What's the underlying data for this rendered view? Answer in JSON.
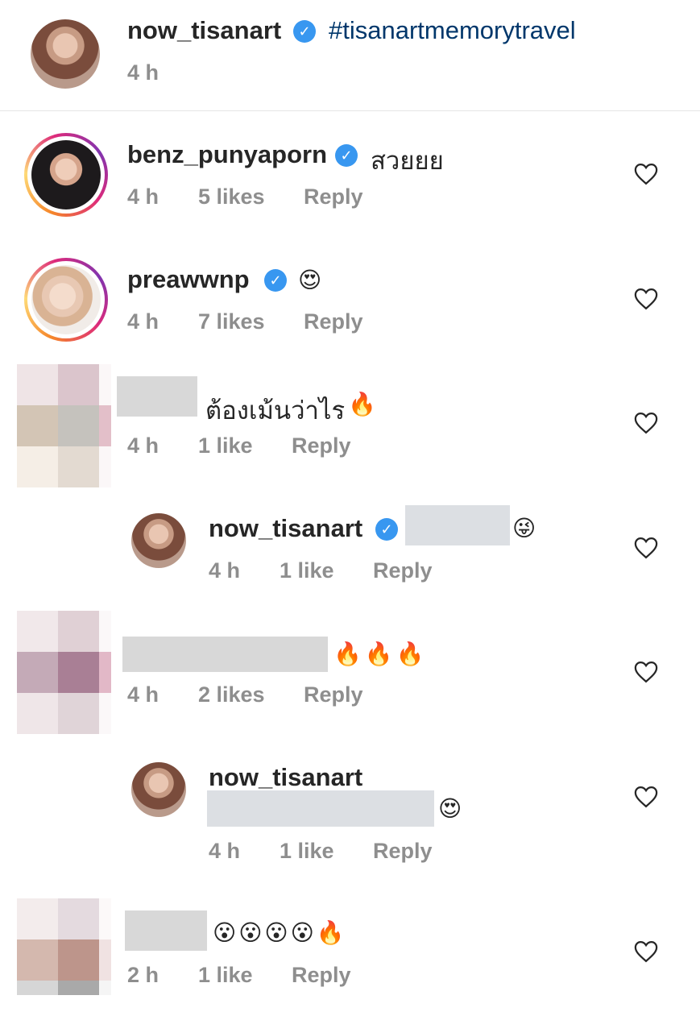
{
  "caption": {
    "username": "now_tisanart",
    "hashtag": "#tisanartmemorytravel",
    "time": "4 h"
  },
  "comments": [
    {
      "username": "benz_punyaporn",
      "text": "สวยยย",
      "time": "4 h",
      "likes": "5 likes",
      "reply": "Reply"
    },
    {
      "username": "preawwnp",
      "emoji": "😍",
      "time": "4 h",
      "likes": "7 likes",
      "reply": "Reply"
    },
    {
      "text": "ต้องเม้นว่าไร",
      "emoji": "🔥",
      "time": "4 h",
      "likes": "1 like",
      "reply": "Reply"
    },
    {
      "username": "now_tisanart",
      "emoji": "😜",
      "time": "4 h",
      "likes": "1 like",
      "reply": "Reply"
    },
    {
      "emoji": "🔥🔥🔥",
      "time": "4 h",
      "likes": "2 likes",
      "reply": "Reply"
    },
    {
      "username": "now_tisanart",
      "emoji": "😍",
      "time": "4 h",
      "likes": "1 like",
      "reply": "Reply"
    },
    {
      "emoji": "😮😮😮😮🔥",
      "time": "2 h",
      "likes": "1 like",
      "reply": "Reply"
    }
  ],
  "icons": {
    "verified": "verified-badge-icon",
    "like": "heart-outline-icon"
  },
  "colors": {
    "verified": "#3897f0",
    "hashtag": "#00376b",
    "meta": "#8e8e8e"
  }
}
